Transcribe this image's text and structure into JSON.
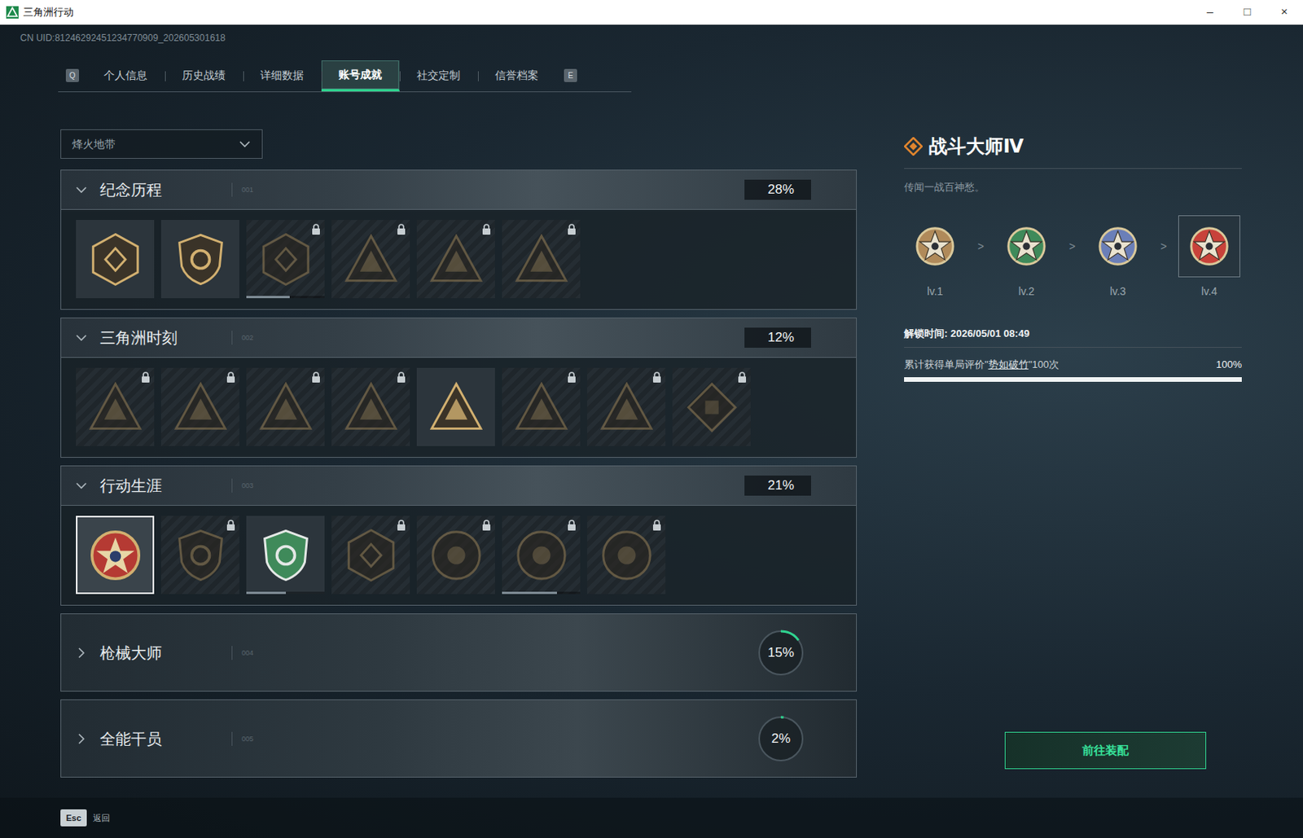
{
  "window": {
    "title": "三角洲行动",
    "controls": [
      "–",
      "□",
      "×"
    ]
  },
  "uid": "CN UID:81246292451234770909_202605301618",
  "tabs": {
    "prev_key": "Q",
    "next_key": "E",
    "items": [
      {
        "label": "个人信息",
        "selected": false
      },
      {
        "label": "历史战绩",
        "selected": false
      },
      {
        "label": "详细数据",
        "selected": false
      },
      {
        "label": "账号成就",
        "selected": true
      },
      {
        "label": "社交定制",
        "selected": false
      },
      {
        "label": "信誉档案",
        "selected": false
      }
    ]
  },
  "mode_select": {
    "value": "烽火地带",
    "expanded": false
  },
  "sections": [
    {
      "title": "纪念历程",
      "code": "001",
      "percent": "28%",
      "expanded": true,
      "badges": [
        {
          "locked": false,
          "selected": false,
          "level": 0
        },
        {
          "locked": false,
          "selected": false,
          "level": 0
        },
        {
          "locked": true,
          "selected": false,
          "level": 0.55
        },
        {
          "locked": true,
          "selected": false,
          "level": 0
        },
        {
          "locked": true,
          "selected": false,
          "level": 0
        },
        {
          "locked": true,
          "selected": false,
          "level": 0
        }
      ]
    },
    {
      "title": "三角洲时刻",
      "code": "002",
      "percent": "12%",
      "expanded": true,
      "badges": [
        {
          "locked": true,
          "selected": false,
          "level": 0
        },
        {
          "locked": true,
          "selected": false,
          "level": 0
        },
        {
          "locked": true,
          "selected": false,
          "level": 0
        },
        {
          "locked": true,
          "selected": false,
          "level": 0
        },
        {
          "locked": false,
          "selected": false,
          "level": 0
        },
        {
          "locked": true,
          "selected": false,
          "level": 0
        },
        {
          "locked": true,
          "selected": false,
          "level": 0
        },
        {
          "locked": true,
          "selected": false,
          "level": 0
        }
      ]
    },
    {
      "title": "行动生涯",
      "code": "003",
      "percent": "21%",
      "expanded": true,
      "badges": [
        {
          "locked": false,
          "selected": true,
          "level": 0
        },
        {
          "locked": true,
          "selected": false,
          "level": 0
        },
        {
          "locked": false,
          "selected": false,
          "level": 0.5
        },
        {
          "locked": true,
          "selected": false,
          "level": 0
        },
        {
          "locked": true,
          "selected": false,
          "level": 0
        },
        {
          "locked": true,
          "selected": false,
          "level": 0.7
        },
        {
          "locked": true,
          "selected": false,
          "level": 0
        }
      ]
    },
    {
      "title": "枪械大师",
      "code": "004",
      "percent": "15%",
      "expanded": false,
      "level": 0.15,
      "badges": []
    },
    {
      "title": "全能干员",
      "code": "005",
      "percent": "2%",
      "expanded": false,
      "level": 0.02,
      "badges": []
    }
  ],
  "detail": {
    "title": "战斗大师Ⅳ",
    "description": "传闻一战百神愁。",
    "levels": [
      {
        "label": "lv.1",
        "selected": false,
        "color": "#b08a5a"
      },
      {
        "label": "lv.2",
        "selected": false,
        "color": "#3f8a5a"
      },
      {
        "label": "lv.3",
        "selected": false,
        "color": "#6b7fb8"
      },
      {
        "label": "lv.4",
        "selected": true,
        "color": "#c8423a"
      }
    ],
    "separators": [
      ">",
      ">",
      ">"
    ],
    "unlock": "解锁时间: 2026/05/01 08:49",
    "requirement": {
      "prefix": "累计获得单局评价\"",
      "highlight": "势如破竹",
      "suffix": "\"100次",
      "percent": "100%",
      "level": 1
    },
    "button": "前往装配"
  },
  "footer": {
    "key": "Esc",
    "label": "返回"
  }
}
